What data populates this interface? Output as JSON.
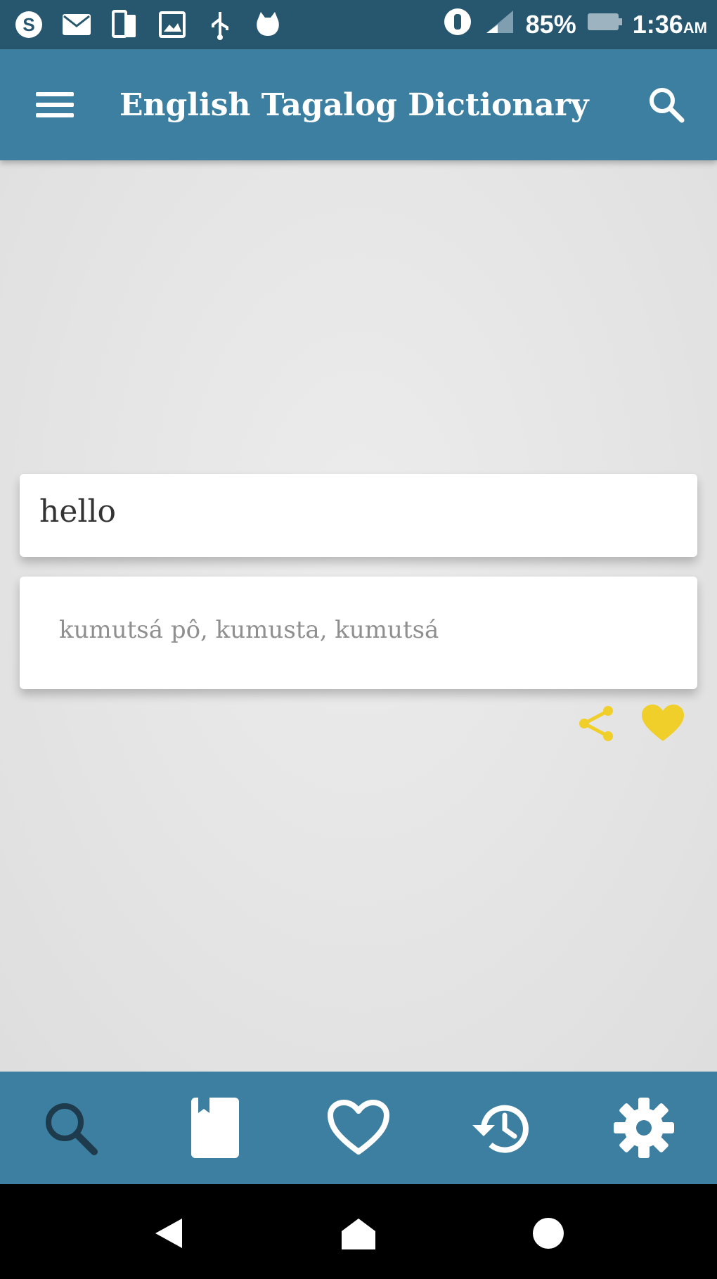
{
  "status_bar": {
    "icons": [
      "skype-icon",
      "mail-icon",
      "dual-sim-icon",
      "image-icon",
      "usb-icon",
      "cat-icon"
    ],
    "right_icons": [
      "alarm-icon",
      "signal-icon"
    ],
    "battery": "85%",
    "time": "1:36",
    "ampm": "AM"
  },
  "app_bar": {
    "title": "English Tagalog Dictionary",
    "menu_icon": "hamburger-menu-icon",
    "search_icon": "search-icon"
  },
  "search": {
    "word": "hello"
  },
  "result": {
    "translation": "kumutsá pô, kumusta, kumutsá"
  },
  "actions": {
    "share_icon": "share-icon",
    "favorite_icon": "heart-icon"
  },
  "bottom_nav": {
    "items": [
      {
        "name": "search-icon"
      },
      {
        "name": "dictionary-book-icon"
      },
      {
        "name": "favorites-heart-icon"
      },
      {
        "name": "history-icon"
      },
      {
        "name": "settings-gear-icon"
      }
    ]
  },
  "system_nav": {
    "buttons": [
      "back-icon",
      "home-icon",
      "recents-icon"
    ]
  },
  "colors": {
    "status_bar": "#27566f",
    "primary": "#3d7fa1",
    "accent": "#f0cf2a",
    "nav_icon_dark": "#1d3b4c"
  }
}
